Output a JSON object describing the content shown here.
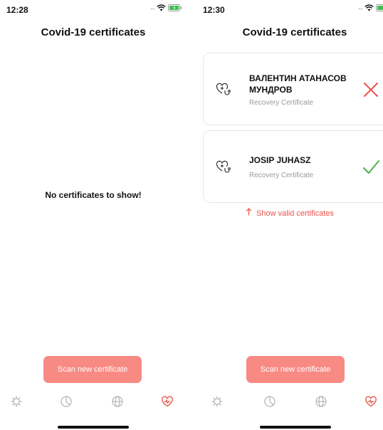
{
  "left": {
    "status_time": "12:28",
    "title": "Covid-19 certificates",
    "empty_message": "No certificates to show!",
    "scan_button_label": "Scan new certificate"
  },
  "right": {
    "status_time": "12:30",
    "title": "Covid-19 certificates",
    "certificates": [
      {
        "name": "ВАЛЕНТИН АТАНАСОВ МУНДРОВ",
        "type": "Recovery Certificate",
        "status": "invalid",
        "status_icon": "cross-icon"
      },
      {
        "name": "JOSIP JUHASZ",
        "type": "Recovery Certificate",
        "status": "valid",
        "status_icon": "checkmark-icon"
      }
    ],
    "show_valid_link": "Show valid certificates",
    "scan_button_label": "Scan new certificate"
  },
  "tabs": [
    {
      "icon": "virus-icon",
      "active": false
    },
    {
      "icon": "pie-chart-icon",
      "active": false
    },
    {
      "icon": "globe-icon",
      "active": false
    },
    {
      "icon": "heart-icon",
      "active": true
    }
  ],
  "colors": {
    "accent": "#e8514a",
    "button": "#f88a84",
    "valid": "#4caf50",
    "invalid": "#e8514a",
    "inactive_tab": "#b5b5b5",
    "battery": "#3cc14e"
  }
}
